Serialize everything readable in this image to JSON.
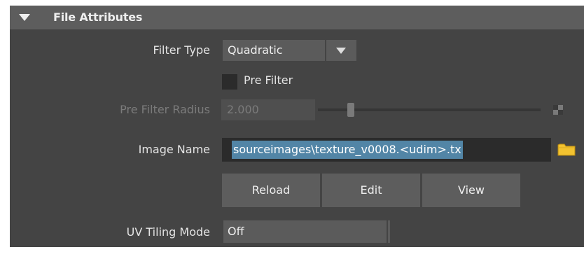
{
  "section": {
    "title": "File Attributes",
    "collapse_icon": "triangle-down-icon"
  },
  "filter_type": {
    "label": "Filter Type",
    "value": "Quadratic",
    "icon": "chevron-down-icon"
  },
  "pre_filter": {
    "label": "Pre Filter",
    "checked": false
  },
  "pre_filter_radius": {
    "label": "Pre Filter Radius",
    "value": "2.000",
    "enabled": false,
    "map_icon": "checker-map-icon"
  },
  "image_name": {
    "label": "Image Name",
    "value": "sourceimages\\texture_v0008.<udim>.tx",
    "browse_icon": "folder-icon"
  },
  "buttons": {
    "reload": "Reload",
    "edit": "Edit",
    "view": "View"
  },
  "uv_tiling": {
    "label": "UV Tiling Mode",
    "value": "Off"
  },
  "colors": {
    "panel_bg": "#444444",
    "header_bg": "#5d5d5d",
    "selection": "#5285a6",
    "folder": "#f2c230"
  }
}
